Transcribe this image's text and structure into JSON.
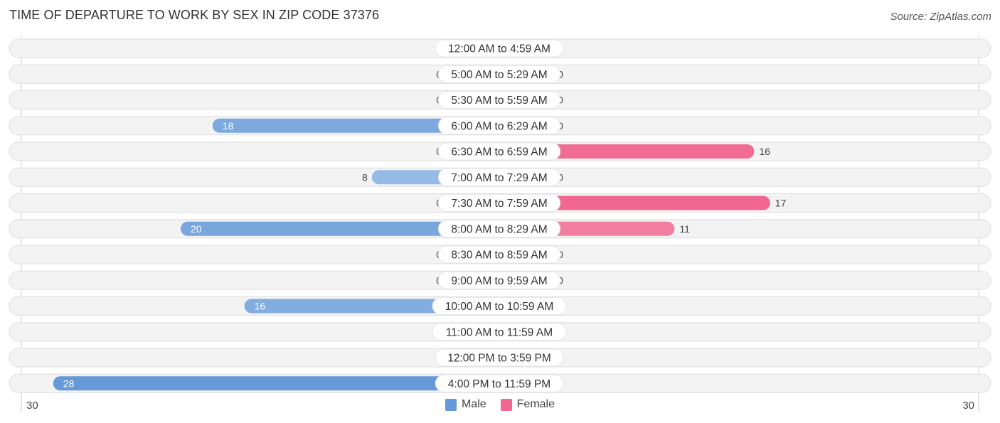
{
  "header": {
    "title": "TIME OF DEPARTURE TO WORK BY SEX IN ZIP CODE 37376",
    "source": "Source: ZipAtlas.com"
  },
  "colors": {
    "male_strong": "#6699d8",
    "male_light": "#a9c7eb",
    "female_strong": "#f06892",
    "female_light": "#f6a9c1",
    "row_bg": "#f3f3f3",
    "row_border": "#dedede"
  },
  "chart_data": {
    "type": "bar",
    "orientation": "horizontal-diverging",
    "title": "TIME OF DEPARTURE TO WORK BY SEX IN ZIP CODE 37376",
    "categories": [
      "12:00 AM to 4:59 AM",
      "5:00 AM to 5:29 AM",
      "5:30 AM to 5:59 AM",
      "6:00 AM to 6:29 AM",
      "6:30 AM to 6:59 AM",
      "7:00 AM to 7:29 AM",
      "7:30 AM to 7:59 AM",
      "8:00 AM to 8:29 AM",
      "8:30 AM to 8:59 AM",
      "9:00 AM to 9:59 AM",
      "10:00 AM to 10:59 AM",
      "11:00 AM to 11:59 AM",
      "12:00 PM to 3:59 PM",
      "4:00 PM to 11:59 PM"
    ],
    "series": [
      {
        "name": "Male",
        "values": [
          0,
          0,
          0,
          18,
          0,
          8,
          0,
          20,
          0,
          0,
          16,
          0,
          0,
          28
        ]
      },
      {
        "name": "Female",
        "values": [
          0,
          0,
          0,
          0,
          16,
          0,
          17,
          11,
          0,
          0,
          0,
          0,
          0,
          0
        ]
      }
    ],
    "axis": {
      "left_label": "30",
      "right_label": "30",
      "max": 30
    },
    "legend": {
      "position": "bottom-center",
      "entries": [
        "Male",
        "Female"
      ]
    },
    "xlabel": "",
    "ylabel": ""
  }
}
